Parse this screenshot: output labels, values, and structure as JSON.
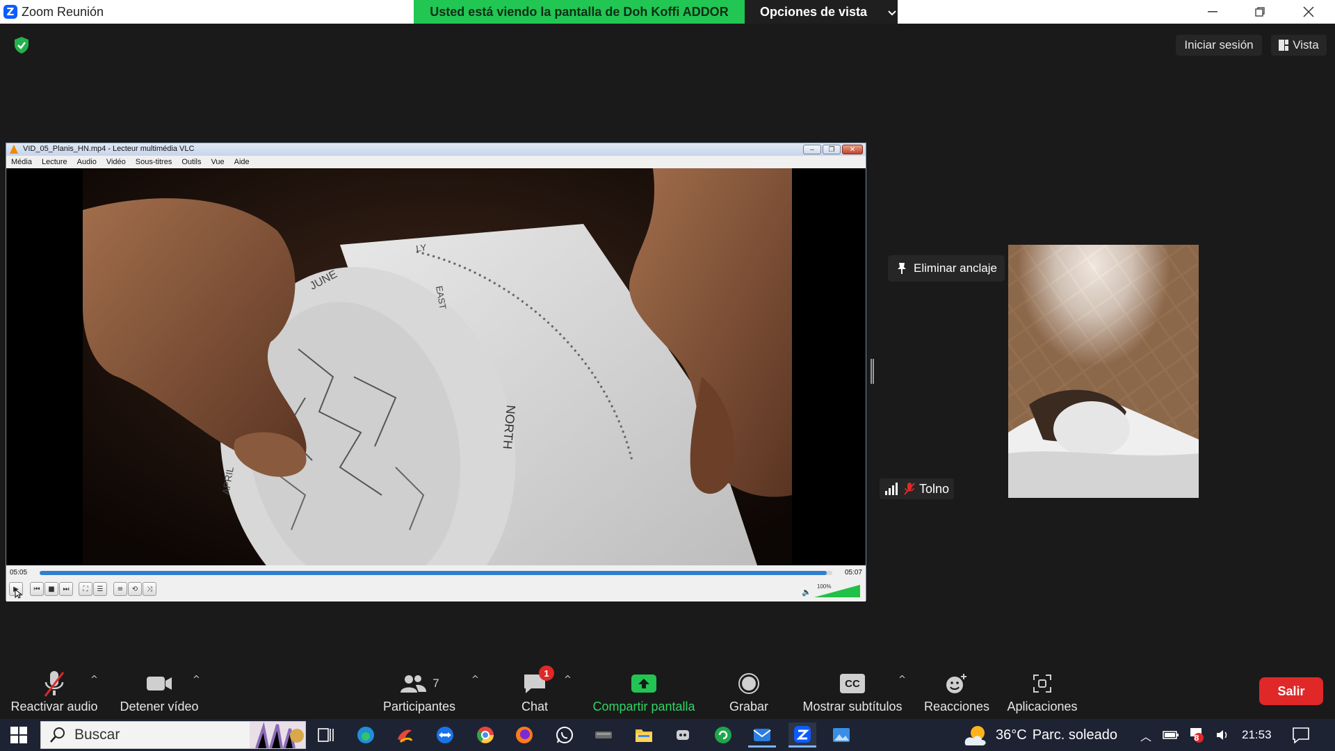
{
  "window": {
    "title": "Zoom Reunión",
    "share_banner": "Usted está viendo la pantalla de Doh Koffi ADDOR",
    "view_options": "Opciones de vista"
  },
  "topbar": {
    "signin": "Iniciar sesión",
    "view": "Vista"
  },
  "vlc": {
    "title": "VID_05_Planis_HN.mp4 - Lecteur multimédia VLC",
    "menu": [
      "Média",
      "Lecture",
      "Audio",
      "Vidéo",
      "Sous-titres",
      "Outils",
      "Vue",
      "Aide"
    ],
    "time_elapsed": "05:05",
    "time_total": "05:07",
    "progress": 0.993,
    "volume": "100%",
    "video_labels": {
      "june": "JUNE",
      "ly": "LY",
      "april": "APRIL",
      "east": "EAST",
      "north": "NORTH"
    }
  },
  "participant": {
    "unpin_label": "Eliminar anclaje",
    "name": "Tolno"
  },
  "toolbar": {
    "unmute": "Reactivar audio",
    "stop_video": "Detener vídeo",
    "participants": "Participantes",
    "participants_count": "7",
    "chat": "Chat",
    "chat_badge": "1",
    "share_screen": "Compartir pantalla",
    "record": "Grabar",
    "captions": "Mostrar subtítulos",
    "captions_icon": "CC",
    "reactions": "Reacciones",
    "apps": "Aplicaciones",
    "leave": "Salir"
  },
  "taskbar": {
    "search_placeholder": "Buscar",
    "weather_temp": "36°C",
    "weather_text": "Parc. soleado",
    "time": "21:53",
    "notification_badge": "8"
  },
  "colors": {
    "zoom_blue": "#0b5cff",
    "share_green": "#21c653",
    "leave_red": "#e02828",
    "vlc_seek": "#2f7fd0"
  }
}
